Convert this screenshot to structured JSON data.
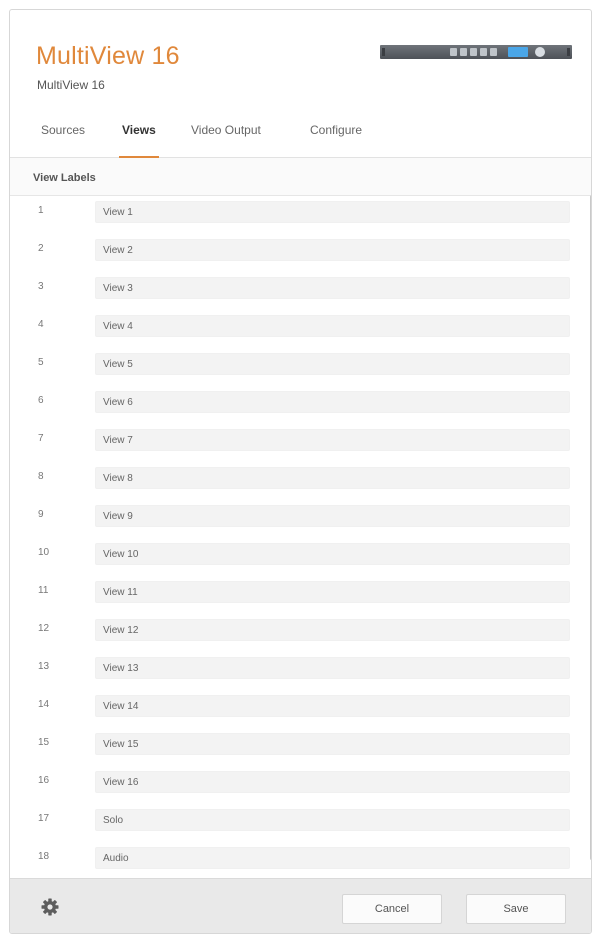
{
  "header": {
    "title": "MultiView 16",
    "subtitle": "MultiView 16"
  },
  "tabs": [
    {
      "label": "Sources",
      "active": false
    },
    {
      "label": "Views",
      "active": true
    },
    {
      "label": "Video Output",
      "active": false
    },
    {
      "label": "Configure",
      "active": false
    }
  ],
  "section": {
    "title": "View Labels"
  },
  "views": [
    {
      "number": "1",
      "label": "View 1"
    },
    {
      "number": "2",
      "label": "View 2"
    },
    {
      "number": "3",
      "label": "View 3"
    },
    {
      "number": "4",
      "label": "View 4"
    },
    {
      "number": "5",
      "label": "View 5"
    },
    {
      "number": "6",
      "label": "View 6"
    },
    {
      "number": "7",
      "label": "View 7"
    },
    {
      "number": "8",
      "label": "View 8"
    },
    {
      "number": "9",
      "label": "View 9"
    },
    {
      "number": "10",
      "label": "View 10"
    },
    {
      "number": "11",
      "label": "View 11"
    },
    {
      "number": "12",
      "label": "View 12"
    },
    {
      "number": "13",
      "label": "View 13"
    },
    {
      "number": "14",
      "label": "View 14"
    },
    {
      "number": "15",
      "label": "View 15"
    },
    {
      "number": "16",
      "label": "View 16"
    },
    {
      "number": "17",
      "label": "Solo"
    },
    {
      "number": "18",
      "label": "Audio"
    }
  ],
  "footer": {
    "cancel_label": "Cancel",
    "save_label": "Save",
    "settings_icon": "gear-icon"
  },
  "colors": {
    "accent": "#e0883b",
    "footer_bg": "#e9e9e9"
  }
}
